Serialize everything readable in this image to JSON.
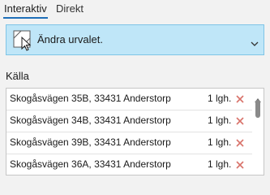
{
  "tabs": {
    "active": "Interaktiv",
    "other": "Direkt"
  },
  "dropdown": {
    "label": "Ändra urvalet."
  },
  "source": {
    "label": "Källa",
    "rows": [
      {
        "address": "Skogåsvägen 35B, 33431 Anderstorp",
        "count": "1 lgh."
      },
      {
        "address": "Skogåsvägen 34B, 33431 Anderstorp",
        "count": "1 lgh."
      },
      {
        "address": "Skogåsvägen 39B, 33431 Anderstorp",
        "count": "1 lgh."
      },
      {
        "address": "Skogåsvägen 36A, 33431 Anderstorp",
        "count": "1 lgh."
      }
    ]
  },
  "colors": {
    "accent": "#1f6fb8",
    "dropdown_bg": "#bfe6f8",
    "remove_icon": "#d9736b"
  }
}
